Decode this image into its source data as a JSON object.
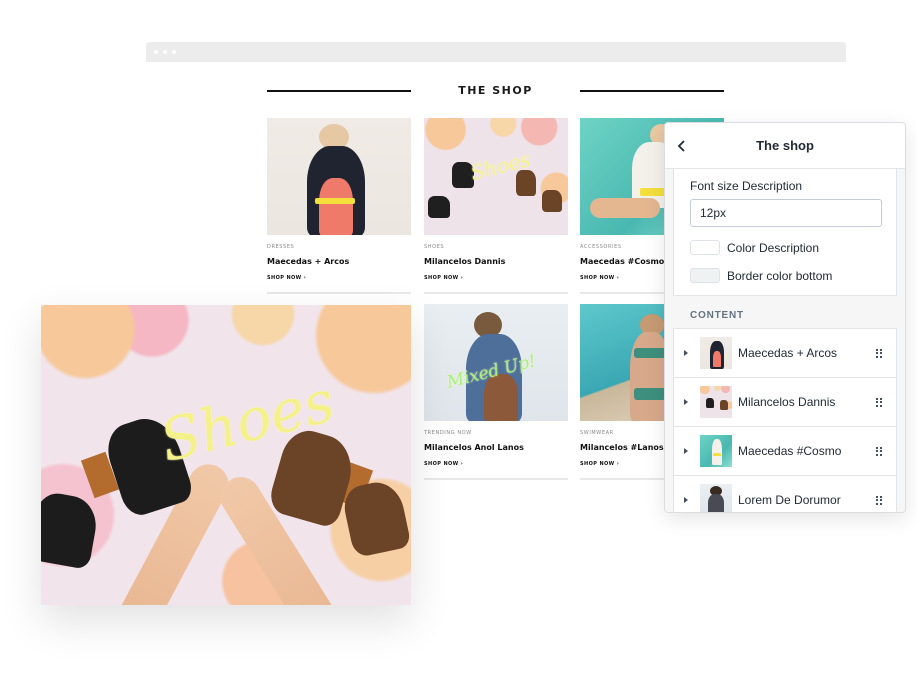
{
  "shop": {
    "title": "THE SHOP",
    "products": [
      {
        "category": "DRESSES",
        "name": "Maecedas + Arcos",
        "link": "SHOP NOW ›"
      },
      {
        "category": "SHOES",
        "name": "Milancelos Dannis",
        "link": "SHOP NOW ›"
      },
      {
        "category": "ACCESSORIES",
        "name": "Maecedas #Cosmo",
        "link": "SHOP NOW ›"
      },
      {
        "category": "",
        "name": "",
        "link": ""
      },
      {
        "category": "TRENDING NOW",
        "name": "Milancelos Anol Lanos",
        "link": "SHOP NOW ›"
      },
      {
        "category": "SWIMWEAR",
        "name": "Milancelos #Lanos",
        "link": "SHOP NOW ›"
      }
    ]
  },
  "panel": {
    "title": "The shop",
    "back_icon": "chevron-left-icon",
    "font_size_label": "Font size Description",
    "font_size_value": "12px",
    "color_description_label": "Color Description",
    "color_description_value": "#ffffff",
    "border_color_label": "Border color bottom",
    "border_color_value": "#eef2f2",
    "content_heading": "CONTENT",
    "content_items": [
      {
        "label": "Maecedas + Arcos"
      },
      {
        "label": "Milancelos Dannis"
      },
      {
        "label": "Maecedas #Cosmo"
      },
      {
        "label": "Lorem De Dorumor"
      }
    ]
  },
  "colors": {
    "accent_text": "#212b36",
    "muted": "#637381"
  }
}
